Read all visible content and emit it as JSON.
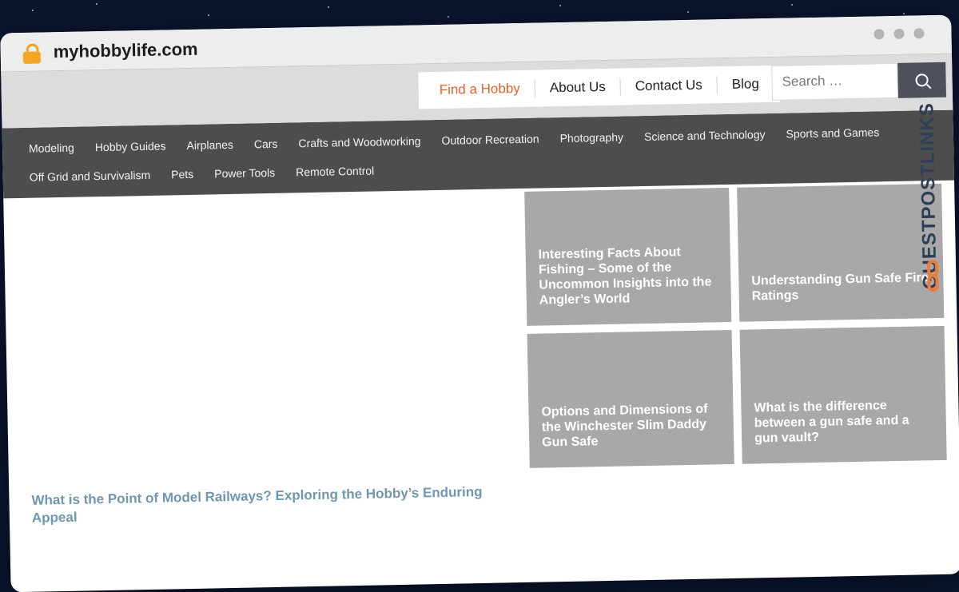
{
  "browser": {
    "url": "myhobbylife.com"
  },
  "top_nav": [
    {
      "label": "Find a Hobby"
    },
    {
      "label": "About Us"
    },
    {
      "label": "Contact Us"
    },
    {
      "label": "Blog"
    }
  ],
  "search": {
    "placeholder": "Search …"
  },
  "categories": [
    {
      "label": "Modeling"
    },
    {
      "label": "Hobby Guides"
    },
    {
      "label": "Airplanes"
    },
    {
      "label": "Cars"
    },
    {
      "label": "Crafts and Woodworking"
    },
    {
      "label": "Outdoor Recreation"
    },
    {
      "label": "Photography"
    },
    {
      "label": "Science and Technology"
    },
    {
      "label": "Sports and Games"
    },
    {
      "label": "Off Grid and Survivalism"
    },
    {
      "label": "Pets"
    },
    {
      "label": "Power Tools"
    },
    {
      "label": "Remote Control"
    }
  ],
  "featured": {
    "title": "What is the Point of Model Railways? Exploring the Hobby’s Enduring Appeal"
  },
  "cards": [
    {
      "title": "Interesting Facts About Fishing – Some of the Uncommon Insights into the Angler’s World"
    },
    {
      "title": "Understanding Gun Safe Fire Ratings"
    },
    {
      "title": "Options and Dimensions of the Winchester Slim Daddy Gun Safe"
    },
    {
      "title": "What is the difference between a gun safe and a gun vault?"
    }
  ],
  "watermark": {
    "text": "GUESTPOSTLINKS"
  },
  "colors": {
    "active_nav": "#e0632c",
    "category_bar": "#4d4d4d",
    "card_bg": "#a8a8a8",
    "featured_title": "#6f97ad"
  }
}
